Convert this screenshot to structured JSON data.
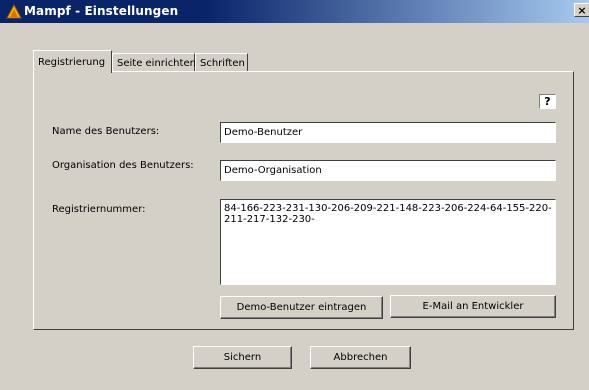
{
  "window": {
    "title": "Mampf - Einstellungen",
    "close_label": "×"
  },
  "tabs": [
    {
      "label": "Registrierung",
      "active": true
    },
    {
      "label": "Seite einrichten",
      "active": false
    },
    {
      "label": "Schriften",
      "active": false
    }
  ],
  "form": {
    "help_label": "?",
    "user_name_label": "Name des Benutzers:",
    "user_name_value": "Demo-Benutzer",
    "organization_label": "Organisation des Benutzers:",
    "organization_value": "Demo-Organisation",
    "regnum_label": "Registriernummer:",
    "regnum_value": "84-166-223-231-130-206-209-221-148-223-206-224-64-155-220-211-217-132-230-",
    "demo_user_button": "Demo-Benutzer eintragen",
    "email_button": "E-Mail an Entwickler"
  },
  "footer": {
    "save_label": "Sichern",
    "cancel_label": "Abbrechen"
  },
  "colors": {
    "titlebar": "#0a246a",
    "face": "#d4d0c8"
  },
  "icons": {
    "app": "mampf-app-icon",
    "close": "close-icon"
  }
}
